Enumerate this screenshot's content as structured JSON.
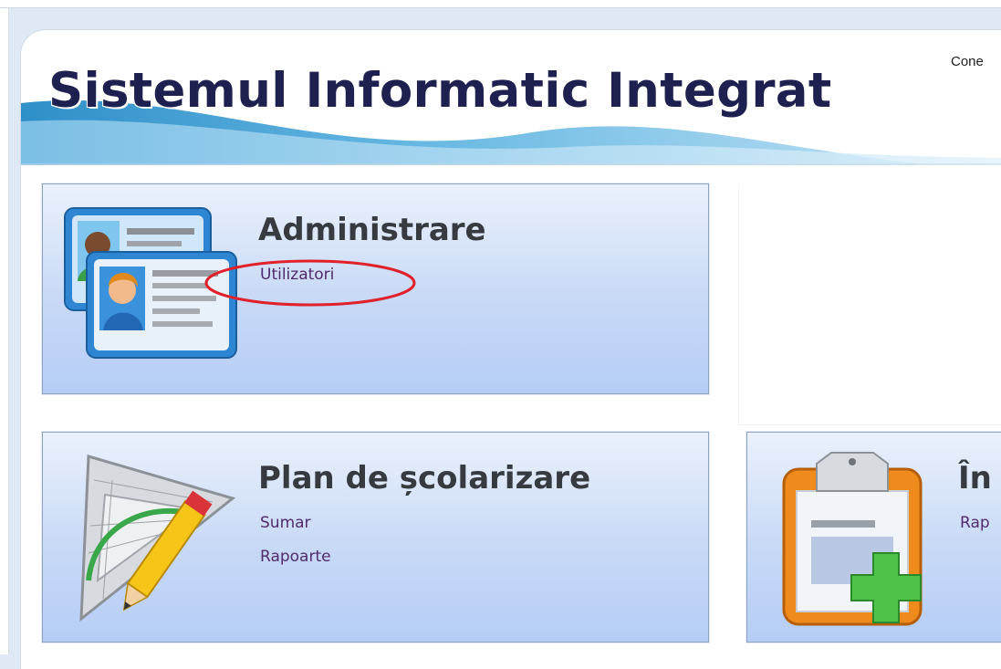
{
  "app": {
    "title": "Sistemul Informatic Integrat",
    "connection_label": "Cone"
  },
  "tiles": [
    {
      "title": "Administrare",
      "icon": "user-cards-icon",
      "links": [
        "Utilizatori"
      ]
    },
    {
      "title": "Plan de școlarizare",
      "icon": "set-square-pencil-icon",
      "links": [
        "Sumar",
        "Rapoarte"
      ]
    },
    {
      "title": "În",
      "icon": "clipboard-add-icon",
      "links": [
        "Rap"
      ]
    }
  ],
  "colors": {
    "title": "#1e2150",
    "link": "#512a6e",
    "tile_border": "#8ea2bd",
    "highlight_circle": "#e0202a"
  }
}
